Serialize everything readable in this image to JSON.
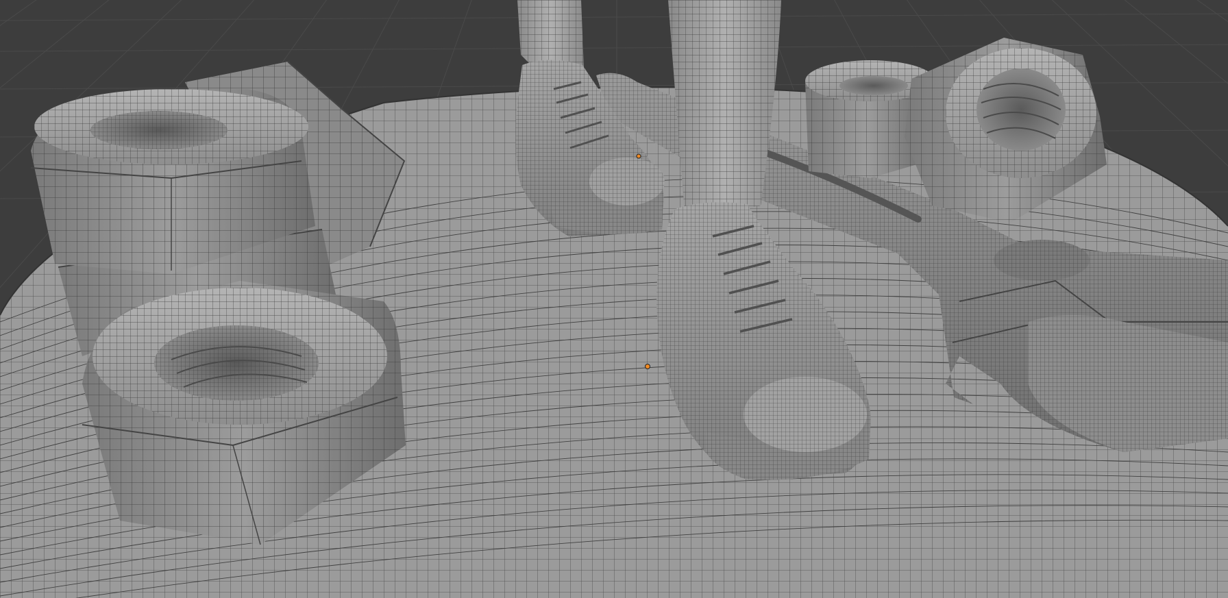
{
  "viewport": {
    "shading": "solid-wireframe",
    "colors": {
      "background": "#3d3d3d",
      "floor_grid": "#4a4a4a",
      "ground": "#9b9b9b",
      "wire": "#3a3a3a",
      "mesh_light": "#a8a8a8",
      "mesh_mid": "#8c8c8c",
      "mesh_dark": "#6b6b6b",
      "mesh_shadow": "#555555",
      "origin_dot": "#f08a24"
    },
    "objects": [
      {
        "name": "ground-disc",
        "icon": "mesh-plane"
      },
      {
        "name": "hex-nut-stack",
        "icon": "mesh-cube",
        "count": 4
      },
      {
        "name": "left-sneaker",
        "icon": "mesh-cube"
      },
      {
        "name": "right-sneaker",
        "icon": "mesh-cube"
      },
      {
        "name": "adjustable-wrench",
        "icon": "mesh-cube"
      },
      {
        "name": "hex-nut-pair",
        "icon": "mesh-cube",
        "count": 2
      }
    ]
  }
}
